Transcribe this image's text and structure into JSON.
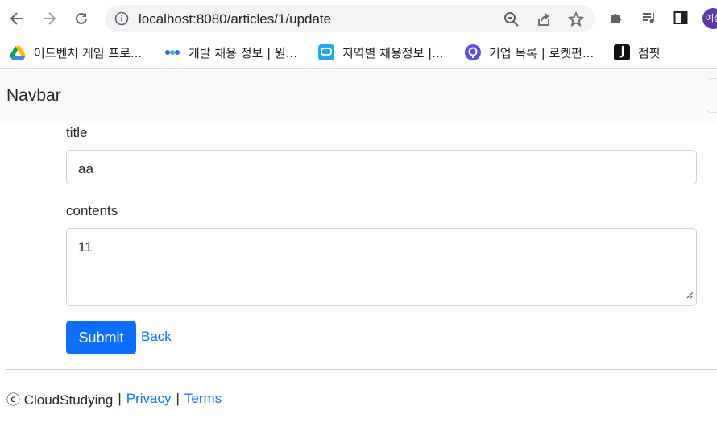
{
  "browser": {
    "url": "localhost:8080/articles/1/update",
    "profile_initial": "예정"
  },
  "bookmarks": [
    {
      "label": "어드벤처 게임 프로...",
      "icon": "google-drive-icon"
    },
    {
      "label": "개발 채용 정보 | 원...",
      "icon": "wanted-icon"
    },
    {
      "label": "지역별 채용정보 |...",
      "icon": "saramin-icon"
    },
    {
      "label": "기업 목록 | 로켓펀...",
      "icon": "rocketpunch-icon"
    },
    {
      "label": "점핏",
      "icon": "jumpit-icon"
    }
  ],
  "navbar": {
    "brand": "Navbar"
  },
  "form": {
    "title_label": "title",
    "title_value": "aa",
    "contents_label": "contents",
    "contents_value": "11",
    "submit_label": "Submit",
    "back_label": "Back"
  },
  "footer": {
    "copyright": "ⓒ CloudStudying",
    "sep1": "|",
    "privacy": "Privacy",
    "sep2": "|",
    "terms": "Terms"
  },
  "colors": {
    "primary": "#0d6efd",
    "navbar_bg": "#f8f9fa"
  }
}
